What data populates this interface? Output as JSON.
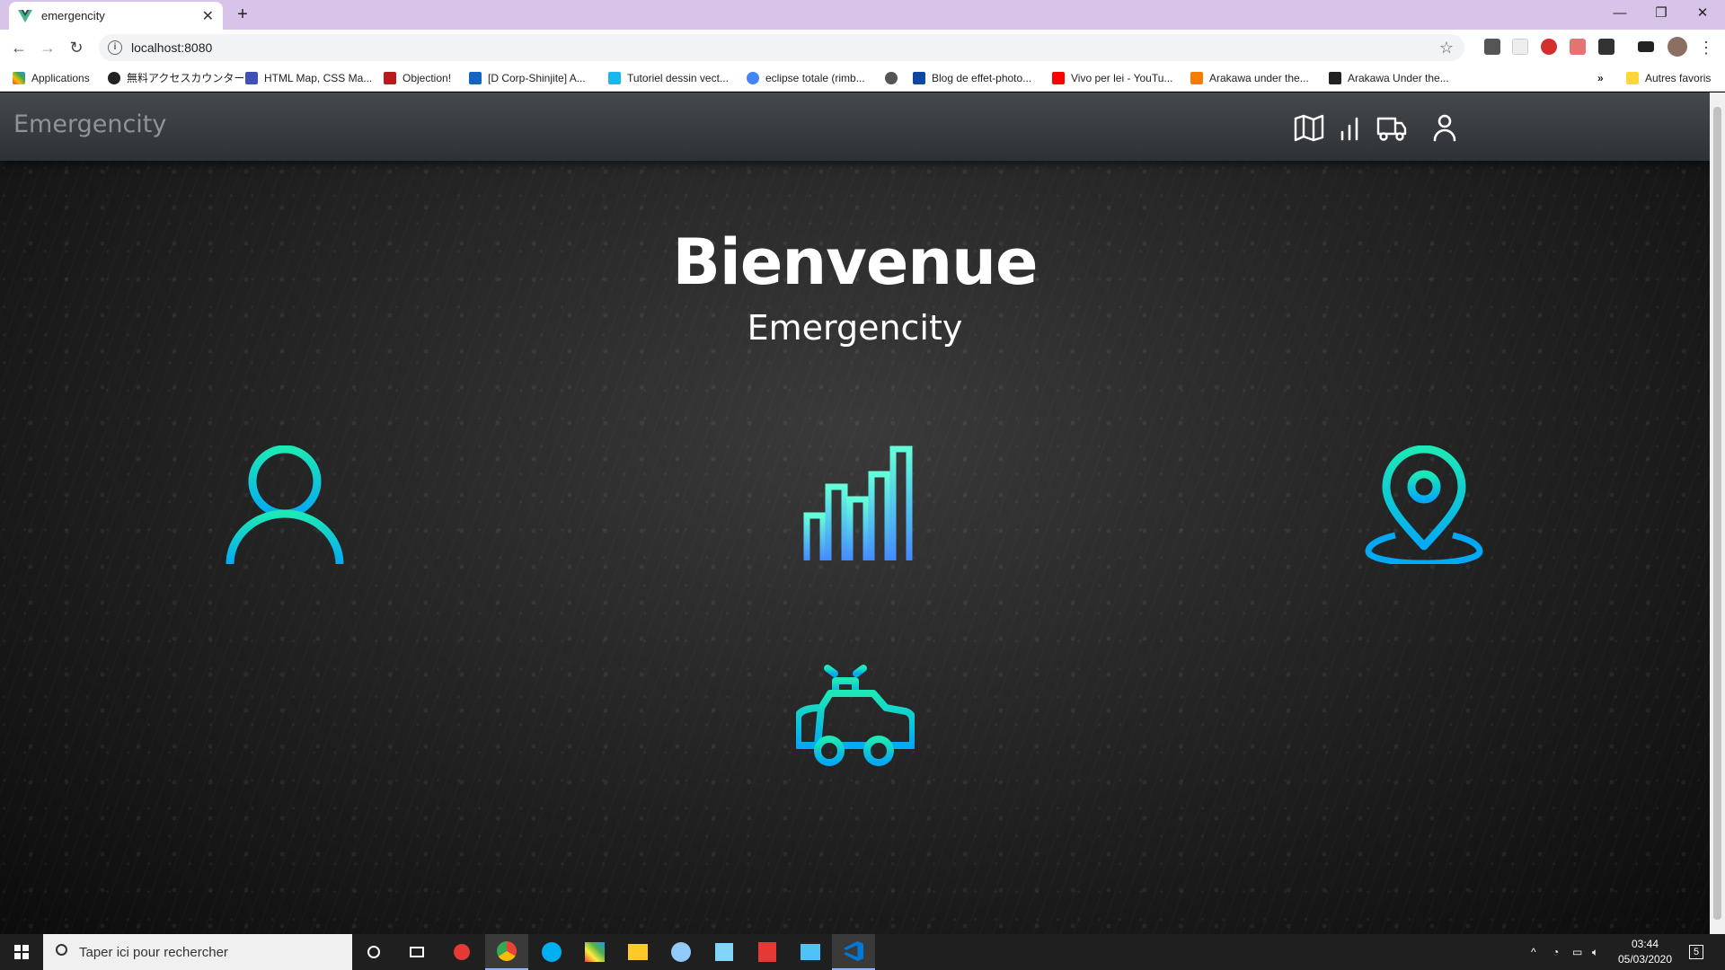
{
  "browser": {
    "tab_title": "emergencity",
    "url": "localhost:8080",
    "bookmarks": [
      "Applications",
      "無料アクセスカウンター...",
      "HTML Map, CSS Ma...",
      "Objection!",
      "[D Corp-Shinjite] A...",
      "Tutoriel dessin vect...",
      "eclipse totale (rimb...",
      "Blog de effet-photo...",
      "Vivo per lei - YouTu...",
      "Arakawa under the...",
      "Arakawa Under the..."
    ],
    "bookmarks_overflow": "»",
    "other_bookmarks": "Autres favoris"
  },
  "app": {
    "brand": "Emergencity",
    "title": "Bienvenue",
    "subtitle": "Emergencity",
    "nav_icons": [
      "map-icon",
      "stats-icon",
      "truck-icon",
      "user-icon"
    ],
    "features": [
      "user-icon",
      "bar-chart-icon",
      "location-pin-icon",
      "police-car-icon"
    ],
    "colors": {
      "gradient_start": "#1de9b6",
      "gradient_end": "#03a9f4",
      "bar_gradient_start": "#64ffda",
      "bar_gradient_end": "#448aff"
    }
  },
  "taskbar": {
    "search_placeholder": "Taper ici pour rechercher",
    "time": "03:44",
    "date": "05/03/2020",
    "notifications": "5"
  }
}
